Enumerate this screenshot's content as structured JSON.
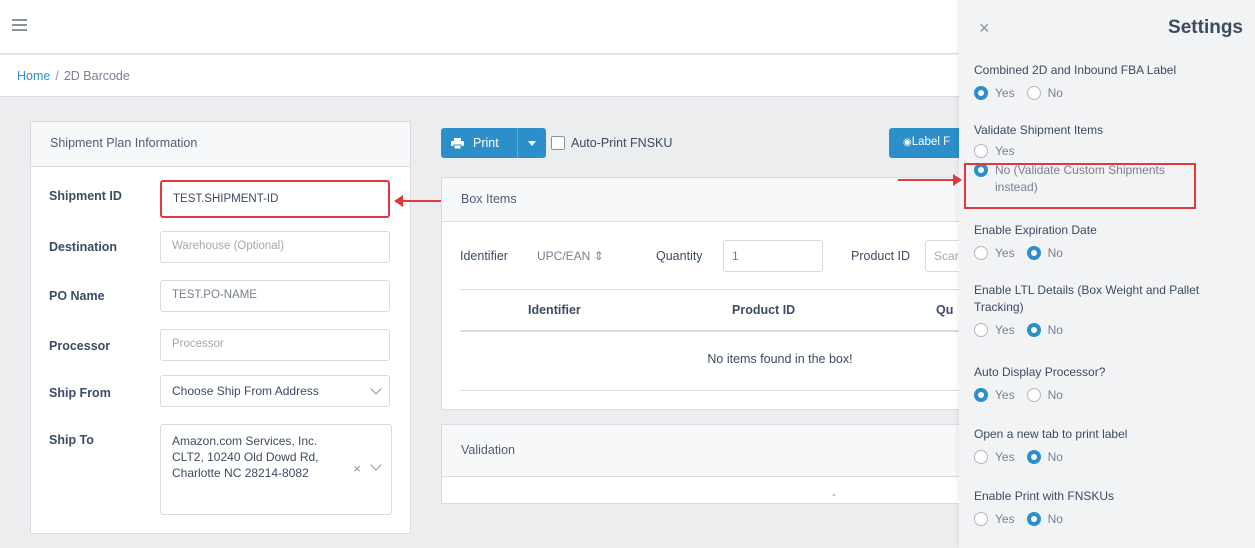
{
  "breadcrumb": {
    "home": "Home",
    "separator": "/",
    "current": "2D Barcode"
  },
  "plan_card": {
    "title": "Shipment Plan Information",
    "fields": {
      "shipment_id": {
        "label": "Shipment ID",
        "value": "TEST.SHIPMENT-ID"
      },
      "destination": {
        "label": "Destination",
        "placeholder": "Warehouse (Optional)"
      },
      "po_name": {
        "label": "PO Name",
        "value": "TEST.PO-NAME"
      },
      "processor": {
        "label": "Processor",
        "placeholder": "Processor"
      },
      "ship_from": {
        "label": "Ship From",
        "value": "Choose Ship From Address"
      },
      "ship_to": {
        "label": "Ship To",
        "value": "Amazon.com Services, Inc. CLT2, 10240 Old Dowd Rd, Charlotte NC 28214-8082"
      }
    }
  },
  "toolbar": {
    "print_label": "Print",
    "auto_print_label": "Auto-Print FNSKU",
    "label_button": "Label F"
  },
  "box_items": {
    "title": "Box Items",
    "identifier_label": "Identifier",
    "identifier_value": "UPC/EAN",
    "quantity_label": "Quantity",
    "quantity_value": "1",
    "product_id_label": "Product ID",
    "product_id_placeholder": "Scar",
    "columns": [
      "Identifier",
      "Product ID",
      "Qu"
    ],
    "empty_text": "No items found in the box!"
  },
  "validation": {
    "title": "Validation",
    "dash": "-"
  },
  "settings": {
    "title": "Settings",
    "close": "×",
    "items": [
      {
        "label": "Combined 2D and Inbound FBA Label",
        "options": [
          "Yes",
          "No"
        ],
        "selected": 0
      },
      {
        "label": "Validate Shipment Items",
        "options": [
          "Yes",
          "No (Validate Custom Shipments instead)"
        ],
        "selected": 1
      },
      {
        "label": "Enable Expiration Date",
        "options": [
          "Yes",
          "No"
        ],
        "selected": 1
      },
      {
        "label": "Enable LTL Details (Box Weight and Pallet Tracking)",
        "options": [
          "Yes",
          "No"
        ],
        "selected": 1
      },
      {
        "label": "Auto Display Processor?",
        "options": [
          "Yes",
          "No"
        ],
        "selected": 0
      },
      {
        "label": "Open a new tab to print label",
        "options": [
          "Yes",
          "No"
        ],
        "selected": 1
      },
      {
        "label": "Enable Print with FNSKUs",
        "options": [
          "Yes",
          "No"
        ],
        "selected": 1
      }
    ]
  },
  "colors": {
    "accent": "#2d8fc9",
    "highlight": "#e0393e"
  }
}
